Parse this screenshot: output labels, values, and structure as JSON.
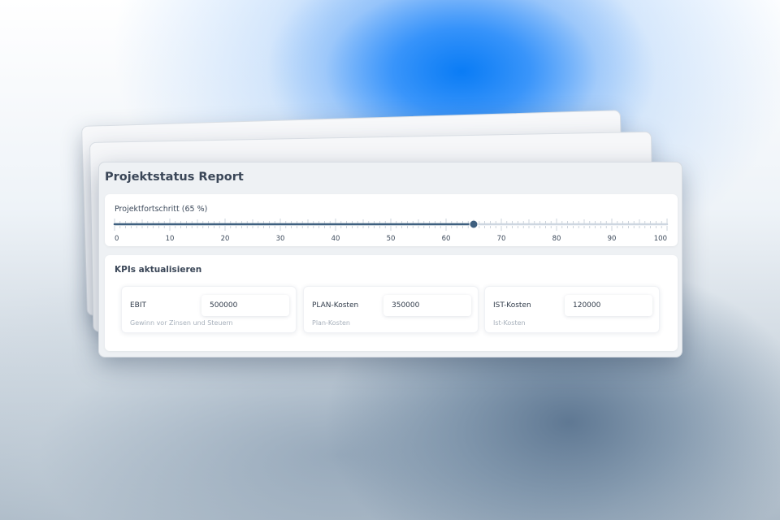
{
  "report": {
    "title": "Projektstatus Report"
  },
  "progress": {
    "label": "Projektfortschritt (65 %)",
    "value": 65,
    "min": 0,
    "max": 100,
    "tick_labels": [
      "0",
      "10",
      "20",
      "30",
      "40",
      "50",
      "60",
      "70",
      "80",
      "90",
      "100"
    ]
  },
  "kpis": {
    "title": "KPIs aktualisieren",
    "items": [
      {
        "label": "EBIT",
        "value": "500000",
        "description": "Gewinn vor Zinsen und Steuern"
      },
      {
        "label": "PLAN-Kosten",
        "value": "350000",
        "description": "Plan-Kosten"
      },
      {
        "label": "IST-Kosten",
        "value": "120000",
        "description": "Ist-Kosten"
      }
    ]
  },
  "colors": {
    "slider_fill": "#3e5f7f",
    "slider_track": "#cdd6e0",
    "thumb": "#3e5f7f"
  }
}
